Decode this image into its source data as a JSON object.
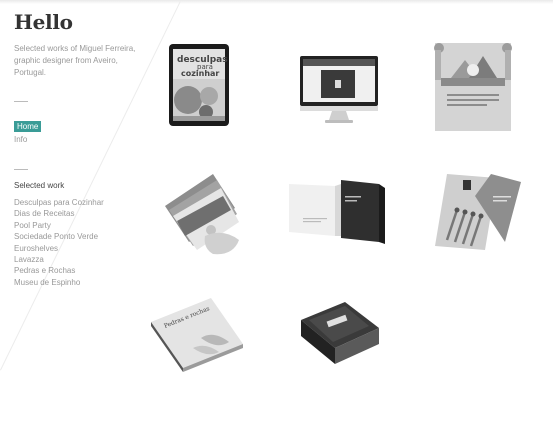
{
  "site": {
    "title": "Hello",
    "intro": "Selected works of Miguel Ferreira, graphic designer from Aveiro, Portugal."
  },
  "nav": {
    "home": "Home",
    "info": "Info"
  },
  "works": {
    "heading": "Selected work",
    "items": [
      "Desculpas para Cozinhar",
      "Dias de Receitas",
      "Pool Party",
      "Sociedade Ponto Verde",
      "Euroshelves",
      "Lavazza",
      "Pedras e Rochas",
      "Museu de Espinho"
    ]
  },
  "thumbnails": [
    {
      "name": "tablet-desculpas",
      "text1": "desculpas",
      "text2": "para",
      "text3": "cozinhar"
    },
    {
      "name": "desktop-monitor"
    },
    {
      "name": "pool-party-poster"
    },
    {
      "name": "flyers-in-hand"
    },
    {
      "name": "open-brochure"
    },
    {
      "name": "euroshelves-catalog"
    },
    {
      "name": "pedras-e-rochas-book",
      "text1": "Pedras e rochas"
    },
    {
      "name": "museum-box"
    }
  ]
}
